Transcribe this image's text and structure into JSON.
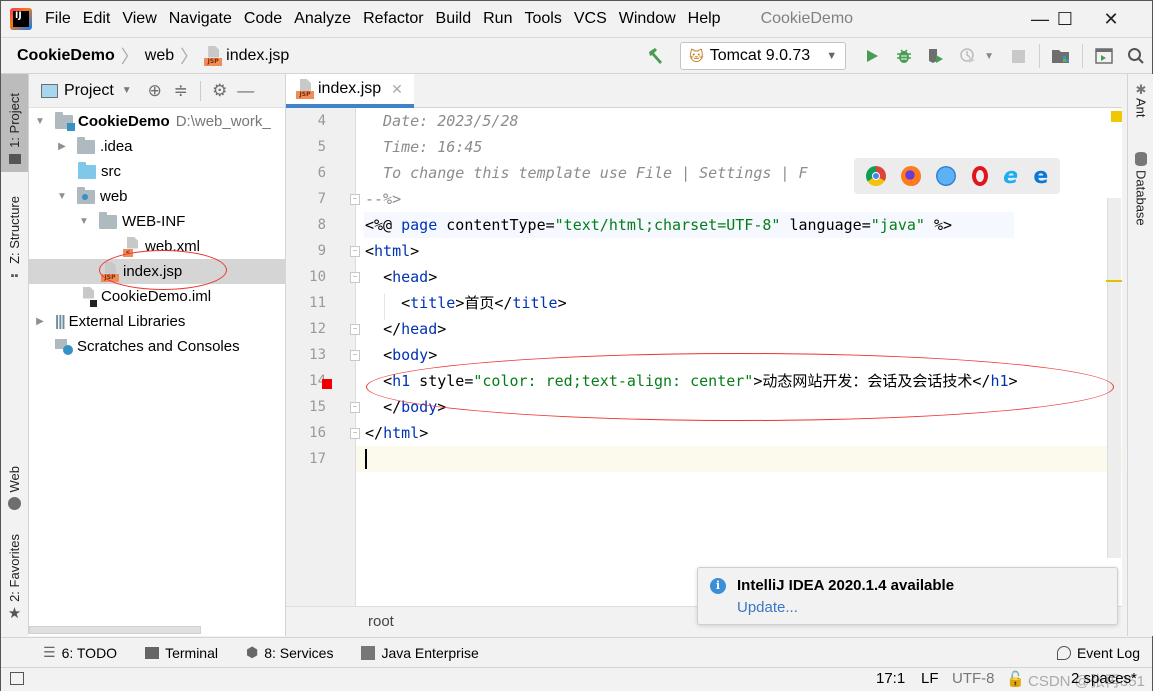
{
  "app": {
    "menu": [
      "File",
      "Edit",
      "View",
      "Navigate",
      "Code",
      "Analyze",
      "Refactor",
      "Build",
      "Run",
      "Tools",
      "VCS",
      "Window",
      "Help"
    ],
    "window_title": "CookieDemo",
    "controls": {
      "minimize": "—",
      "maximize": "☐",
      "close": "✕"
    }
  },
  "navbar": {
    "breadcrumb": [
      "CookieDemo",
      "web",
      "index.jsp"
    ],
    "run_config": "Tomcat 9.0.73",
    "accent_green": "#499c54"
  },
  "left_strip": {
    "tabs": [
      "1: Project",
      "Z: Structure",
      "Web",
      "2: Favorites"
    ]
  },
  "right_strip": {
    "tabs": [
      "Ant",
      "Database"
    ]
  },
  "project": {
    "title": "Project",
    "tree": [
      {
        "label": "CookieDemo",
        "extra": "D:\\web_work_",
        "level": 0,
        "expanded": true,
        "icon": "module-folder-icon",
        "bold": true
      },
      {
        "label": ".idea",
        "level": 1,
        "expanded": false,
        "icon": "folder-icon"
      },
      {
        "label": "src",
        "level": 1,
        "icon": "source-folder-icon"
      },
      {
        "label": "web",
        "level": 1,
        "expanded": true,
        "icon": "web-folder-icon"
      },
      {
        "label": "WEB-INF",
        "level": 2,
        "expanded": true,
        "icon": "folder-icon"
      },
      {
        "label": "web.xml",
        "level": 3,
        "icon": "xml-file-icon"
      },
      {
        "label": "index.jsp",
        "level": 2,
        "icon": "jsp-file-icon",
        "selected": true
      },
      {
        "label": "CookieDemo.iml",
        "level": 1,
        "icon": "iml-file-icon"
      },
      {
        "label": "External Libraries",
        "level": 0,
        "expanded": false,
        "icon": "library-icon"
      },
      {
        "label": "Scratches and Consoles",
        "level": 0,
        "icon": "scratches-icon"
      }
    ]
  },
  "editor": {
    "tab_label": "index.jsp",
    "lines": [
      {
        "n": "4",
        "text": "  Date: 2023/5/28"
      },
      {
        "n": "5",
        "text": "  Time: 16:45"
      },
      {
        "n": "6",
        "text": "  To change this template use File | Settings | F"
      },
      {
        "n": "7",
        "text": "--%>"
      },
      {
        "n": "8",
        "text": "<%@ page contentType=\"text/html;charset=UTF-8\" language=\"java\" %>"
      },
      {
        "n": "9",
        "text": "<html>"
      },
      {
        "n": "10",
        "text": "  <head>"
      },
      {
        "n": "11",
        "text": "    <title>首页</title>"
      },
      {
        "n": "12",
        "text": "  </head>"
      },
      {
        "n": "13",
        "text": "  <body>"
      },
      {
        "n": "14",
        "text": "  <h1 style=\"color: red;text-align: center\">动态网站开发：会话及会话技术</h1>"
      },
      {
        "n": "15",
        "text": "  </body>"
      },
      {
        "n": "16",
        "text": "</html>"
      },
      {
        "n": "17",
        "text": ""
      }
    ],
    "breadcrumb": "root",
    "browsers": [
      "chrome-icon",
      "firefox-icon",
      "safari-icon",
      "opera-icon",
      "ie-icon",
      "edge-icon"
    ]
  },
  "notification": {
    "title": "IntelliJ IDEA 2020.1.4 available",
    "link": "Update..."
  },
  "bottom_tools": [
    "6: TODO",
    "Terminal",
    "8: Services",
    "Java Enterprise"
  ],
  "event_log": "Event Log",
  "status": {
    "position": "17:1",
    "line_sep": "LF",
    "encoding": "UTF-8",
    "indent": "2 spaces*",
    "watermark": "CSDN @张再351"
  }
}
